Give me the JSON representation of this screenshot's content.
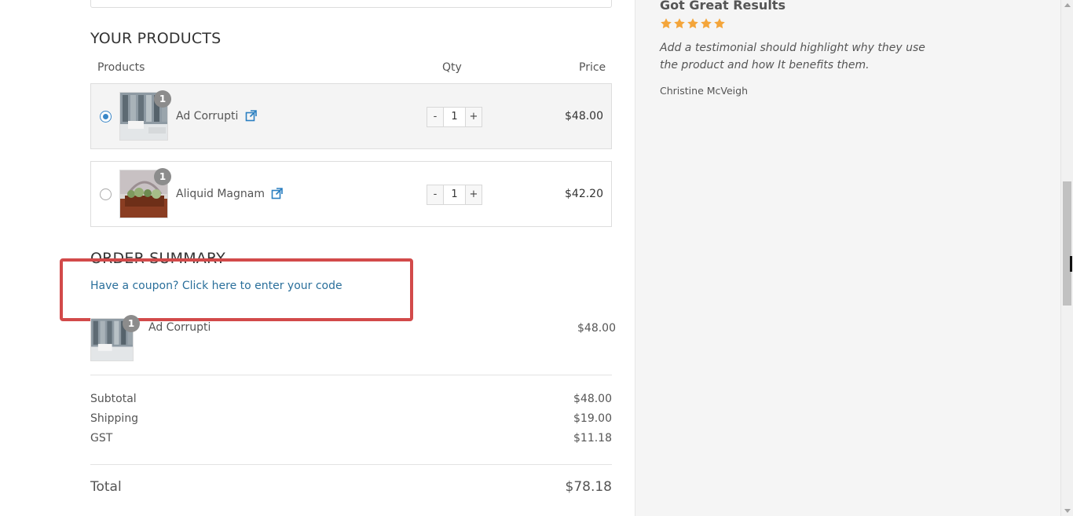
{
  "products_section": {
    "title": "YOUR PRODUCTS",
    "columns": {
      "products": "Products",
      "qty": "Qty",
      "price": "Price"
    },
    "items": [
      {
        "name": "Ad Corrupti",
        "badge": "1",
        "qty": "1",
        "price": "$48.00",
        "selected": true,
        "minus": "-",
        "plus": "+"
      },
      {
        "name": "Aliquid Magnam",
        "badge": "1",
        "qty": "1",
        "price": "$42.20",
        "selected": false,
        "minus": "-",
        "plus": "+"
      }
    ]
  },
  "order_summary": {
    "title": "ORDER SUMMARY",
    "coupon_link": "Have a coupon? Click here to enter your code",
    "line_item": {
      "name": "Ad Corrupti",
      "badge": "1",
      "price": "$48.00"
    },
    "subtotal": {
      "label": "Subtotal",
      "value": "$48.00"
    },
    "shipping": {
      "label": "Shipping",
      "value": "$19.00"
    },
    "tax": {
      "label": "GST",
      "value": "$11.18"
    },
    "total": {
      "label": "Total",
      "value": "$78.18"
    }
  },
  "testimonial": {
    "title": "Got Great Results",
    "rating": 5,
    "star_color": "#f4a53a",
    "text": "Add a testimonial should highlight why they use the product and how It benefits them.",
    "author": "Christine McVeigh"
  },
  "colors": {
    "link": "#2a6f9b",
    "highlight_border": "#d24a4a",
    "radio_accent": "#3a87c8",
    "sidebar_bg": "#f5f5f5"
  }
}
